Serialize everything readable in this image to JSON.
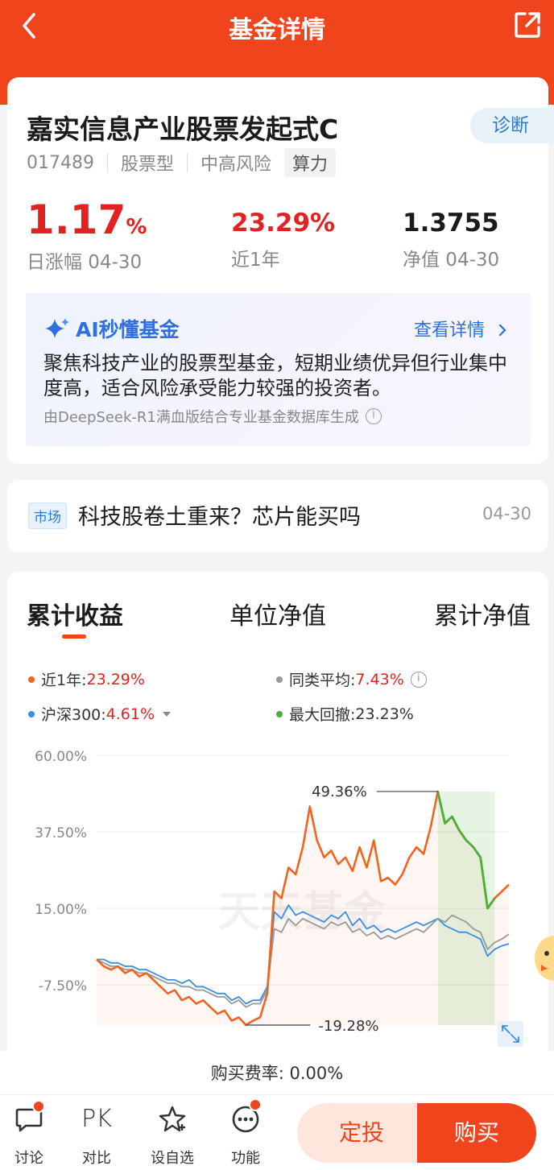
{
  "header": {
    "title": "基金详情"
  },
  "fund": {
    "name": "嘉实信息产业股票发起式C",
    "code": "017489",
    "type": "股票型",
    "risk": "中高风险",
    "theme_tag": "算力",
    "diagnose_label": "诊断",
    "daily_change_value": "1.17",
    "daily_change_unit": "%",
    "daily_change_label": "日涨幅 04-30",
    "one_year_value": "23.29%",
    "one_year_label": "近1年",
    "nav_value": "1.3755",
    "nav_label": "净值 04-30"
  },
  "ai_summary": {
    "title": "AI秒懂基金",
    "more_label": "查看详情",
    "text": "聚焦科技产业的股票型基金，短期业绩优异但行业集中度高，适合风险承受能力较强的投资者。",
    "source": "由DeepSeek-R1满血版结合专业基金数据库生成"
  },
  "news": {
    "tag": "市场",
    "title": "科技股卷土重来？芯片能买吗",
    "date": "04-30"
  },
  "chart_tabs": [
    "累计收益",
    "单位净值",
    "累计净值"
  ],
  "legend": {
    "fund_label": "近1年:",
    "fund_value": "23.29%",
    "peer_label": "同类平均:",
    "peer_value": "7.43%",
    "index_label": "沪深300:",
    "index_value": "4.61%",
    "drawdown_label": "最大回撤:",
    "drawdown_value": "23.23%"
  },
  "colors": {
    "brand": "#f0441d",
    "fund_line": "#f0641e",
    "peer_line": "#999999",
    "index_line": "#3a8ee6",
    "drawdown_line": "#4caf39",
    "up_red": "#e42121"
  },
  "chart_data": {
    "type": "line",
    "ylim": [
      -19.28,
      60
    ],
    "yticks": [
      "60.00%",
      "37.50%",
      "15.00%",
      "-7.50%"
    ],
    "max_label": "49.36%",
    "min_label": "-19.28%",
    "watermark": "天天基金",
    "drawdown_range_index": [
      48,
      56
    ],
    "series": [
      {
        "name": "近1年",
        "values": [
          0,
          -2,
          -3,
          -2,
          -4,
          -3,
          -5,
          -4,
          -6,
          -8,
          -10,
          -9,
          -12,
          -11,
          -13,
          -12,
          -14,
          -16,
          -15,
          -18,
          -17,
          -19.28,
          -18,
          -17,
          -10,
          20,
          18,
          27,
          25,
          33,
          45,
          35,
          30,
          32,
          28,
          30,
          26,
          33,
          27,
          35,
          23,
          24,
          22,
          25,
          30,
          33,
          31,
          39,
          49.36,
          40,
          42,
          38,
          35,
          33,
          30,
          15,
          18,
          20,
          22
        ]
      },
      {
        "name": "同类平均",
        "values": [
          0,
          -1,
          -2,
          -2,
          -3,
          -3,
          -4,
          -4,
          -5,
          -6,
          -7,
          -7,
          -8,
          -8,
          -9,
          -9,
          -10,
          -11,
          -11,
          -13,
          -12,
          -14,
          -13,
          -13,
          -9,
          9,
          8,
          12,
          10,
          12,
          11,
          10,
          9,
          11,
          10,
          11,
          8,
          9,
          7,
          8,
          6,
          7,
          6,
          7,
          8,
          9,
          8,
          10,
          12,
          11,
          13,
          12,
          11,
          9,
          8,
          3,
          5,
          6,
          7.43
        ]
      },
      {
        "name": "沪深300",
        "values": [
          0,
          0,
          -1,
          -1,
          -2,
          -2,
          -3,
          -3,
          -4,
          -5,
          -6,
          -6,
          -7,
          -6,
          -8,
          -8,
          -9,
          -10,
          -10,
          -12,
          -11,
          -13,
          -12,
          -12,
          -8,
          14,
          12,
          16,
          13,
          14,
          13,
          12,
          11,
          13,
          12,
          14,
          10,
          12,
          9,
          10,
          8,
          9,
          8,
          9,
          10,
          11,
          10,
          11,
          12,
          10,
          9,
          8,
          8,
          7,
          6,
          1,
          3,
          4,
          4.61
        ]
      }
    ]
  },
  "fee": {
    "text": "购买费率: 0.00%"
  },
  "tabbar": {
    "discuss": "讨论",
    "compare_glyph": "PK",
    "compare": "对比",
    "watchlist": "设自选",
    "functions": "功能",
    "sip": "定投",
    "buy": "购买"
  }
}
